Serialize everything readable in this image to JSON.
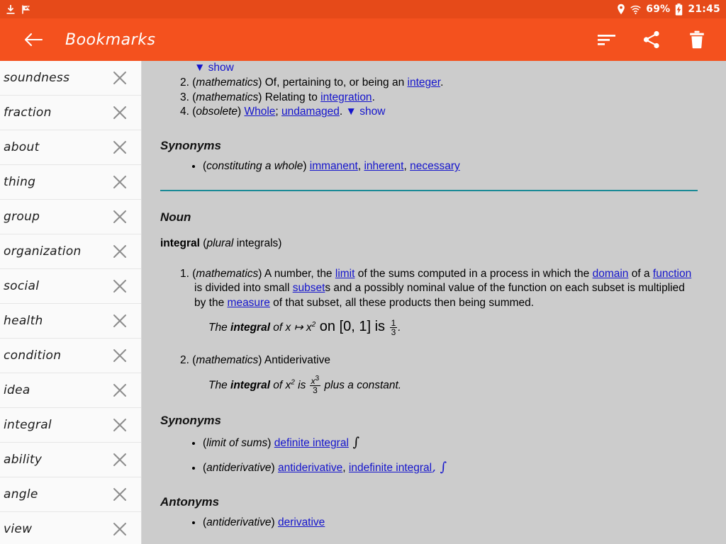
{
  "status_bar": {
    "left_icons": [
      "download-icon",
      "flag-icon"
    ],
    "location_icon": "location-pin-icon",
    "wifi_icon": "wifi-icon",
    "battery_percent": "69%",
    "battery_icon": "battery-charging-icon",
    "time": "21:45",
    "background_color": "#e64a19"
  },
  "app_bar": {
    "back_label": "back-arrow",
    "title": "Bookmarks",
    "actions": [
      {
        "name": "sort-button",
        "label": "Sort"
      },
      {
        "name": "share-button",
        "label": "Share"
      },
      {
        "name": "delete-button",
        "label": "Delete"
      }
    ],
    "background_color": "#f4511e"
  },
  "sidebar": {
    "items": [
      {
        "label": "soundness"
      },
      {
        "label": "fraction"
      },
      {
        "label": "about"
      },
      {
        "label": "thing"
      },
      {
        "label": "group"
      },
      {
        "label": "organization"
      },
      {
        "label": "social"
      },
      {
        "label": "health"
      },
      {
        "label": "condition"
      },
      {
        "label": "idea"
      },
      {
        "label": "integral"
      },
      {
        "label": "ability"
      },
      {
        "label": "angle"
      },
      {
        "label": "view"
      }
    ],
    "remove_icon": "close-x-icon",
    "background_color": "#fafafa"
  },
  "article": {
    "link_color": "#1414cc",
    "divider_color": "#1a8a96",
    "show_toggle_label": "show",
    "show_toggle_arrow": "▼",
    "adj_senses": [
      {
        "number": "2.",
        "qualifier": "mathematics",
        "text_before": "Of, pertaining to, or being an ",
        "link": "integer",
        "text_after": "."
      },
      {
        "number": "3.",
        "qualifier": "mathematics",
        "text_before": "Relating to ",
        "link": "integration",
        "text_after": "."
      },
      {
        "number": "4.",
        "qualifier": "obsolete",
        "link1": "Whole",
        "sep": "; ",
        "link2": "undamaged",
        "text_after": ". "
      }
    ],
    "adj_synonyms_heading": "Synonyms",
    "adj_synonyms": {
      "qualifier": "constituting a whole",
      "links": [
        "immanent",
        "inherent",
        "necessary"
      ]
    },
    "noun_heading": "Noun",
    "noun_headword": "integral",
    "noun_inflection_label": "plural",
    "noun_inflection": "integrals",
    "noun_sense_1": {
      "number": "1.",
      "qualifier": "mathematics",
      "p1": "A number, the ",
      "l1": "limit",
      "p2": " of the sums computed in a process in which the ",
      "l2": "domain",
      "p3": " of a ",
      "l3": "function",
      "p4": " is divided into small ",
      "l4": "subset",
      "p5": "s and a possibly nominal value of the function on each subset is multiplied by the ",
      "l5": "measure",
      "p6": " of that subset, all these products then being summed."
    },
    "noun_example_1": {
      "p1": "The ",
      "bold": "integral",
      "p2": " of x ↦ x",
      "sup": "2",
      "p3": " on [0, 1] is ",
      "frac_num": "1",
      "frac_den": "3",
      "p4": "."
    },
    "noun_sense_2": {
      "number": "2.",
      "qualifier": "mathematics",
      "text": "Antiderivative"
    },
    "noun_example_2": {
      "p1": "The ",
      "bold": "integral",
      "p2": " of x",
      "sup": "2",
      "p3": " is ",
      "frac_num": "x",
      "frac_num_sup": "3",
      "frac_den": "3",
      "p4": " plus a constant."
    },
    "noun_synonyms_heading": "Synonyms",
    "noun_synonyms": [
      {
        "qualifier": "limit of sums",
        "links": [
          "definite integral"
        ],
        "trailing": " ∫"
      },
      {
        "qualifier": "antiderivative",
        "links": [
          "antiderivative",
          "indefinite integral"
        ],
        "trailing": ", ∫"
      }
    ],
    "antonyms_heading": "Antonyms",
    "antonyms": [
      {
        "qualifier": "antiderivative",
        "links": [
          "derivative"
        ]
      }
    ]
  }
}
